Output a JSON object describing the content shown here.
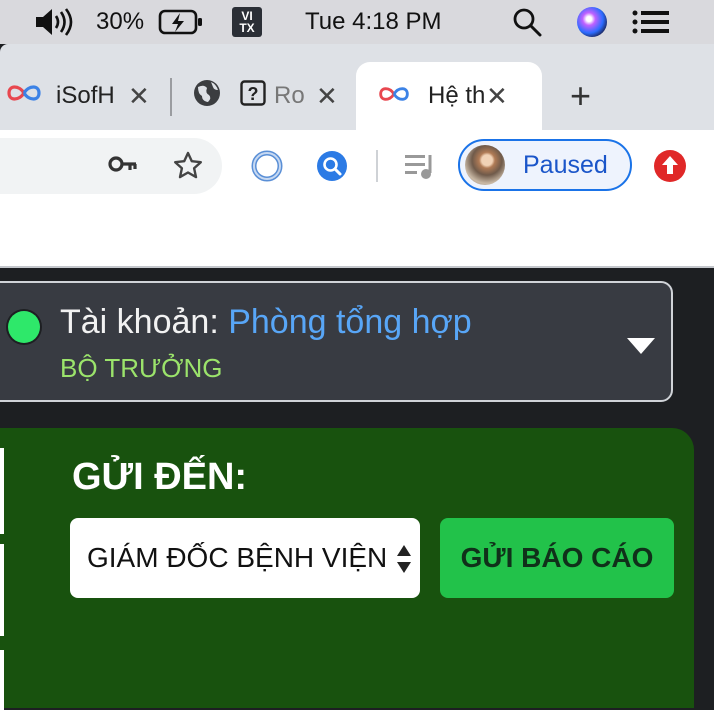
{
  "menubar": {
    "battery_percent": "30%",
    "input_method": {
      "line1": "VI",
      "line2": "TX"
    },
    "clock": "Tue 4:18 PM",
    "icons": [
      "speaker-icon",
      "battery-charging-icon",
      "search-icon",
      "siri-icon",
      "control-center-icon"
    ]
  },
  "browser": {
    "tabs": [
      {
        "title": "iSofH",
        "active": false,
        "favicon": "infinity-logo-icon"
      },
      {
        "title": "Ro",
        "active": false,
        "favicon": "question-box-icon"
      },
      {
        "title": "Hệ th",
        "active": true,
        "favicon": "infinity-logo-icon"
      }
    ],
    "new_tab_label": "+",
    "profile_status": "Paused"
  },
  "account": {
    "label": "Tài khoản: ",
    "name": "Phòng tổng hợp",
    "role": "BỘ TRƯỞNG",
    "status_color": "#2ee86a"
  },
  "report": {
    "send_to_label": "GỬI ĐẾN:",
    "selected_recipient": "GIÁM ĐỐC BỆNH VIỆN",
    "submit_label": "GỬI BÁO CÁO",
    "panel_color": "#18520e",
    "button_color": "#22c24a"
  }
}
